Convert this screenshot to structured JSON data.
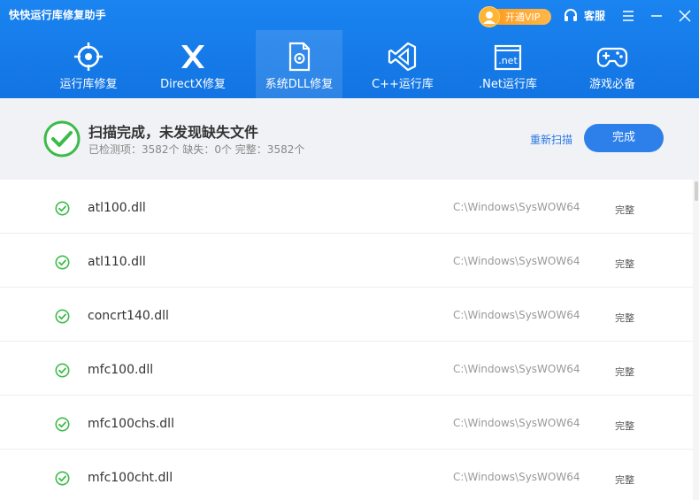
{
  "app": {
    "title": "快快运行库修复助手"
  },
  "header": {
    "vip_label": "开通VIP",
    "service_label": "客服"
  },
  "tabs": [
    {
      "label": "运行库修复",
      "icon": "target-icon",
      "active": false
    },
    {
      "label": "DirectX修复",
      "icon": "directx-icon",
      "active": false
    },
    {
      "label": "系统DLL修复",
      "icon": "dll-file-icon",
      "active": true
    },
    {
      "label": "C++运行库",
      "icon": "visual-studio-icon",
      "active": false
    },
    {
      "label": ".Net运行库",
      "icon": "dotnet-icon",
      "active": false
    },
    {
      "label": "游戏必备",
      "icon": "gamepad-icon",
      "active": false
    }
  ],
  "status": {
    "title": "扫描完成，未发现缺失文件",
    "summary": "已检测项：3582个   缺失：0个   完整：3582个",
    "rescan_label": "重新扫描",
    "done_label": "完成"
  },
  "files": [
    {
      "name": "atl100.dll",
      "path": "C:\\Windows\\SysWOW64",
      "status": "完整"
    },
    {
      "name": "atl110.dll",
      "path": "C:\\Windows\\SysWOW64",
      "status": "完整"
    },
    {
      "name": "concrt140.dll",
      "path": "C:\\Windows\\SysWOW64",
      "status": "完整"
    },
    {
      "name": "mfc100.dll",
      "path": "C:\\Windows\\SysWOW64",
      "status": "完整"
    },
    {
      "name": "mfc100chs.dll",
      "path": "C:\\Windows\\SysWOW64",
      "status": "完整"
    },
    {
      "name": "mfc100cht.dll",
      "path": "C:\\Windows\\SysWOW64",
      "status": "完整"
    }
  ],
  "colors": {
    "header": "#1677e5",
    "accent": "#2d80ea",
    "success": "#3dbb4a",
    "vip": "#ffa52b"
  }
}
